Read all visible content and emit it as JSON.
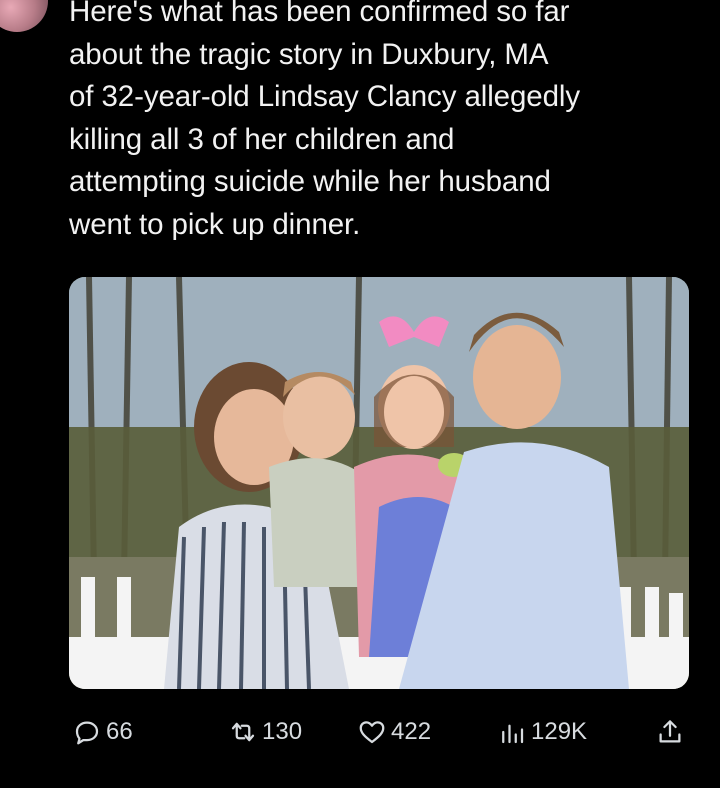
{
  "tweet": {
    "text": "Here's what has been confirmed so far\nabout the tragic story in Duxbury, MA\nof 32-year-old Lindsay Clancy allegedly\nkilling all 3 of her children and\nattempting suicide while her husband\nwent to pick up dinner."
  },
  "actions": {
    "reply": {
      "icon": "reply-icon",
      "count": "66"
    },
    "retweet": {
      "icon": "retweet-icon",
      "count": "130"
    },
    "like": {
      "icon": "heart-icon",
      "count": "422"
    },
    "views": {
      "icon": "views-chart-icon",
      "count": "129K"
    },
    "share": {
      "icon": "share-icon"
    }
  },
  "colors": {
    "background": "#000000",
    "text": "#f2f2f2",
    "icon": "#d7dbdf"
  }
}
